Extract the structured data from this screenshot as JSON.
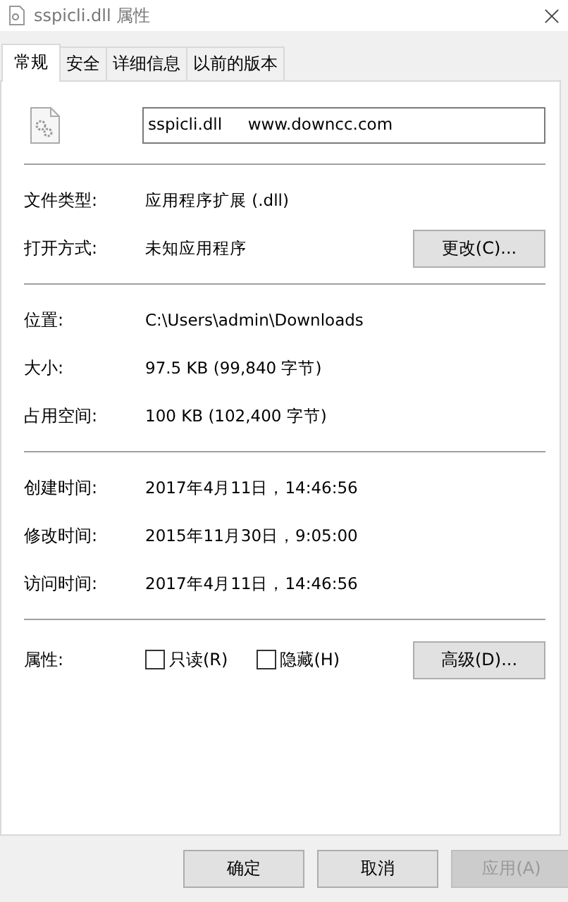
{
  "window": {
    "title": "sspicli.dll 属性"
  },
  "tabs": [
    {
      "label": "常规",
      "selected": true
    },
    {
      "label": "安全",
      "selected": false
    },
    {
      "label": "详细信息",
      "selected": false
    },
    {
      "label": "以前的版本",
      "selected": false
    }
  ],
  "file_name": {
    "value": "sspicli.dll     www.downcc.com"
  },
  "groups": [
    [
      {
        "label": "文件类型:",
        "value": "应用程序扩展 (.dll)"
      },
      {
        "label": "打开方式:",
        "value": "未知应用程序",
        "button": "更改(C)..."
      }
    ],
    [
      {
        "label": "位置:",
        "value": "C:\\Users\\admin\\Downloads"
      },
      {
        "label": "大小:",
        "value": "97.5 KB (99,840 字节)"
      },
      {
        "label": "占用空间:",
        "value": "100 KB (102,400 字节)"
      }
    ],
    [
      {
        "label": "创建时间:",
        "value": "2017年4月11日，14:46:56"
      },
      {
        "label": "修改时间:",
        "value": "2015年11月30日，9:05:00"
      },
      {
        "label": "访问时间:",
        "value": "2017年4月11日，14:46:56"
      }
    ]
  ],
  "attributes": {
    "label": "属性:",
    "options": [
      {
        "label": "只读(R)",
        "checked": false
      },
      {
        "label": "隐藏(H)",
        "checked": false
      }
    ],
    "button": "高级(D)..."
  },
  "footer_buttons": [
    {
      "label": "确定",
      "disabled": false
    },
    {
      "label": "取消",
      "disabled": false
    },
    {
      "label": "应用(A)",
      "disabled": true
    }
  ]
}
